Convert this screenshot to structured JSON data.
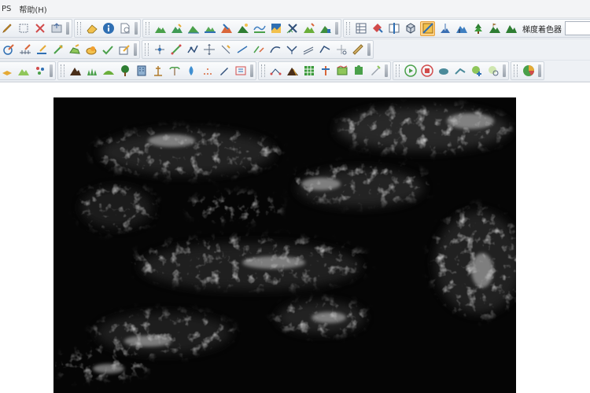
{
  "menu": {
    "item_ps": "PS",
    "item_help": "帮助(H)"
  },
  "toolbar": {
    "renderer_select": {
      "value": "梯度着色器"
    }
  },
  "colors": {
    "toolbar_bg": "#eef1f5",
    "canvas_bg": "#000000",
    "active_tool": "#ffd48a"
  }
}
